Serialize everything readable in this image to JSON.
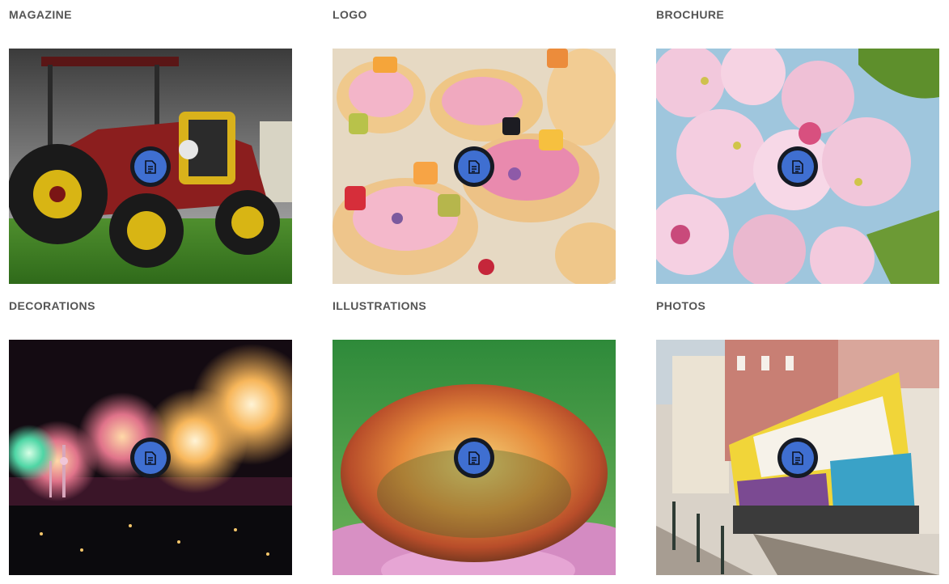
{
  "gallery": {
    "items": [
      {
        "label": "MAGAZINE",
        "icon": "document-icon"
      },
      {
        "label": "LOGO",
        "icon": "document-icon"
      },
      {
        "label": "BROCHURE",
        "icon": "document-icon"
      },
      {
        "label": "DECORATIONS",
        "icon": "document-icon"
      },
      {
        "label": "ILLUSTRATIONS",
        "icon": "document-icon"
      },
      {
        "label": "PHOTOS",
        "icon": "document-icon"
      }
    ]
  },
  "colors": {
    "label_text": "#555555",
    "button_ring": "#151a24",
    "button_fill": "#3f6fd1"
  }
}
